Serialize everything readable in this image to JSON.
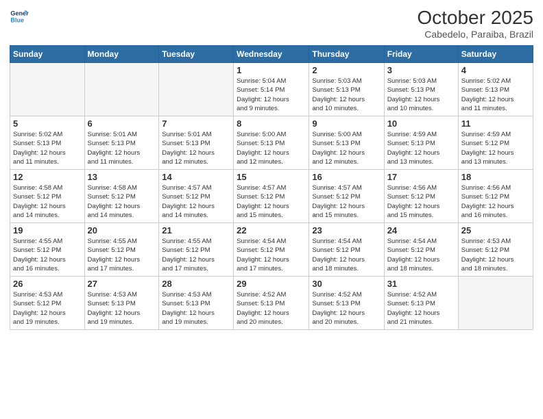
{
  "header": {
    "logo_text_general": "General",
    "logo_text_blue": "Blue",
    "month_title": "October 2025",
    "location": "Cabedelo, Paraiba, Brazil"
  },
  "days_of_week": [
    "Sunday",
    "Monday",
    "Tuesday",
    "Wednesday",
    "Thursday",
    "Friday",
    "Saturday"
  ],
  "weeks": [
    [
      {
        "day": "",
        "info": ""
      },
      {
        "day": "",
        "info": ""
      },
      {
        "day": "",
        "info": ""
      },
      {
        "day": "1",
        "info": "Sunrise: 5:04 AM\nSunset: 5:14 PM\nDaylight: 12 hours\nand 9 minutes."
      },
      {
        "day": "2",
        "info": "Sunrise: 5:03 AM\nSunset: 5:13 PM\nDaylight: 12 hours\nand 10 minutes."
      },
      {
        "day": "3",
        "info": "Sunrise: 5:03 AM\nSunset: 5:13 PM\nDaylight: 12 hours\nand 10 minutes."
      },
      {
        "day": "4",
        "info": "Sunrise: 5:02 AM\nSunset: 5:13 PM\nDaylight: 12 hours\nand 11 minutes."
      }
    ],
    [
      {
        "day": "5",
        "info": "Sunrise: 5:02 AM\nSunset: 5:13 PM\nDaylight: 12 hours\nand 11 minutes."
      },
      {
        "day": "6",
        "info": "Sunrise: 5:01 AM\nSunset: 5:13 PM\nDaylight: 12 hours\nand 11 minutes."
      },
      {
        "day": "7",
        "info": "Sunrise: 5:01 AM\nSunset: 5:13 PM\nDaylight: 12 hours\nand 12 minutes."
      },
      {
        "day": "8",
        "info": "Sunrise: 5:00 AM\nSunset: 5:13 PM\nDaylight: 12 hours\nand 12 minutes."
      },
      {
        "day": "9",
        "info": "Sunrise: 5:00 AM\nSunset: 5:13 PM\nDaylight: 12 hours\nand 12 minutes."
      },
      {
        "day": "10",
        "info": "Sunrise: 4:59 AM\nSunset: 5:13 PM\nDaylight: 12 hours\nand 13 minutes."
      },
      {
        "day": "11",
        "info": "Sunrise: 4:59 AM\nSunset: 5:12 PM\nDaylight: 12 hours\nand 13 minutes."
      }
    ],
    [
      {
        "day": "12",
        "info": "Sunrise: 4:58 AM\nSunset: 5:12 PM\nDaylight: 12 hours\nand 14 minutes."
      },
      {
        "day": "13",
        "info": "Sunrise: 4:58 AM\nSunset: 5:12 PM\nDaylight: 12 hours\nand 14 minutes."
      },
      {
        "day": "14",
        "info": "Sunrise: 4:57 AM\nSunset: 5:12 PM\nDaylight: 12 hours\nand 14 minutes."
      },
      {
        "day": "15",
        "info": "Sunrise: 4:57 AM\nSunset: 5:12 PM\nDaylight: 12 hours\nand 15 minutes."
      },
      {
        "day": "16",
        "info": "Sunrise: 4:57 AM\nSunset: 5:12 PM\nDaylight: 12 hours\nand 15 minutes."
      },
      {
        "day": "17",
        "info": "Sunrise: 4:56 AM\nSunset: 5:12 PM\nDaylight: 12 hours\nand 15 minutes."
      },
      {
        "day": "18",
        "info": "Sunrise: 4:56 AM\nSunset: 5:12 PM\nDaylight: 12 hours\nand 16 minutes."
      }
    ],
    [
      {
        "day": "19",
        "info": "Sunrise: 4:55 AM\nSunset: 5:12 PM\nDaylight: 12 hours\nand 16 minutes."
      },
      {
        "day": "20",
        "info": "Sunrise: 4:55 AM\nSunset: 5:12 PM\nDaylight: 12 hours\nand 17 minutes."
      },
      {
        "day": "21",
        "info": "Sunrise: 4:55 AM\nSunset: 5:12 PM\nDaylight: 12 hours\nand 17 minutes."
      },
      {
        "day": "22",
        "info": "Sunrise: 4:54 AM\nSunset: 5:12 PM\nDaylight: 12 hours\nand 17 minutes."
      },
      {
        "day": "23",
        "info": "Sunrise: 4:54 AM\nSunset: 5:12 PM\nDaylight: 12 hours\nand 18 minutes."
      },
      {
        "day": "24",
        "info": "Sunrise: 4:54 AM\nSunset: 5:12 PM\nDaylight: 12 hours\nand 18 minutes."
      },
      {
        "day": "25",
        "info": "Sunrise: 4:53 AM\nSunset: 5:12 PM\nDaylight: 12 hours\nand 18 minutes."
      }
    ],
    [
      {
        "day": "26",
        "info": "Sunrise: 4:53 AM\nSunset: 5:12 PM\nDaylight: 12 hours\nand 19 minutes."
      },
      {
        "day": "27",
        "info": "Sunrise: 4:53 AM\nSunset: 5:13 PM\nDaylight: 12 hours\nand 19 minutes."
      },
      {
        "day": "28",
        "info": "Sunrise: 4:53 AM\nSunset: 5:13 PM\nDaylight: 12 hours\nand 19 minutes."
      },
      {
        "day": "29",
        "info": "Sunrise: 4:52 AM\nSunset: 5:13 PM\nDaylight: 12 hours\nand 20 minutes."
      },
      {
        "day": "30",
        "info": "Sunrise: 4:52 AM\nSunset: 5:13 PM\nDaylight: 12 hours\nand 20 minutes."
      },
      {
        "day": "31",
        "info": "Sunrise: 4:52 AM\nSunset: 5:13 PM\nDaylight: 12 hours\nand 21 minutes."
      },
      {
        "day": "",
        "info": ""
      }
    ]
  ]
}
